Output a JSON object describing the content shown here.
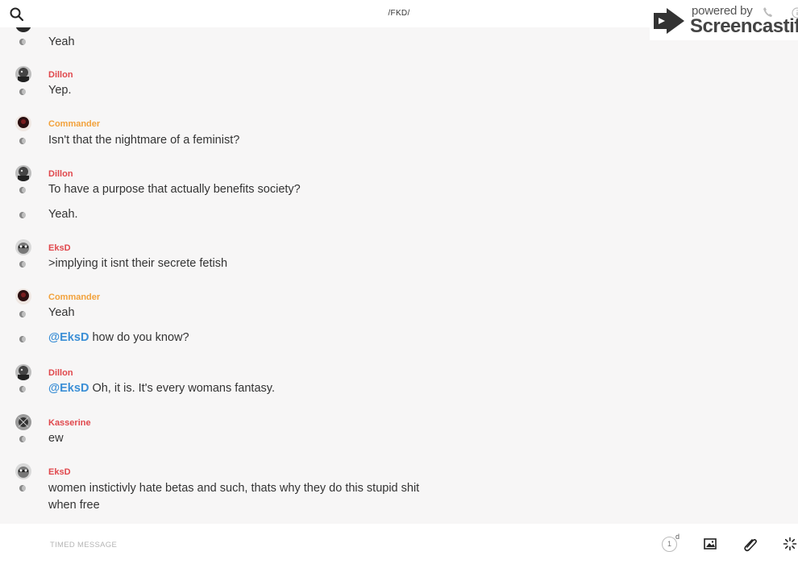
{
  "header": {
    "title": "/FKD/",
    "search_icon": "search-icon"
  },
  "watermark": {
    "powered": "powered by",
    "brand": "Screencastify"
  },
  "messages": [
    {
      "author": "",
      "author_color": "",
      "text": "Yeah",
      "avatar": "avatar-partial"
    },
    {
      "author": "Dillon",
      "author_color": "#e0474c",
      "text": "Yep.",
      "avatar": "dillon-avatar"
    },
    {
      "author": "Commander",
      "author_color": "#f2a23c",
      "text": "Isn't that the nightmare of a feminist?",
      "avatar": "commander-avatar"
    },
    {
      "author": "Dillon",
      "author_color": "#e0474c",
      "text": "To have a purpose that actually benefits society?",
      "avatar": "dillon-avatar"
    },
    {
      "author": "",
      "author_color": "",
      "text": "Yeah.",
      "avatar": ""
    },
    {
      "author": "EksD",
      "author_color": "#e0474c",
      "text": ">implying it isnt their secrete fetish",
      "avatar": "eksd-avatar"
    },
    {
      "author": "Commander",
      "author_color": "#f2a23c",
      "text": "Yeah",
      "avatar": "commander-avatar"
    },
    {
      "author": "",
      "author_color": "",
      "mention": "@EksD",
      "text": " how do you know?",
      "avatar": ""
    },
    {
      "author": "Dillon",
      "author_color": "#e0474c",
      "mention": "@EksD",
      "text": " Oh, it is. It's every womans fantasy.",
      "avatar": "dillon-avatar"
    },
    {
      "author": "Kasserine",
      "author_color": "#e0474c",
      "text": "ew",
      "avatar": "kasserine-avatar"
    },
    {
      "author": "EksD",
      "author_color": "#e0474c",
      "text": "women instictivly hate betas and such, thats why they do this stupid shit when free",
      "avatar": "eksd-avatar"
    }
  ],
  "composer": {
    "placeholder": "TIMED MESSAGE",
    "timer_value": "1",
    "timer_unit": "d"
  },
  "colors": {
    "author_red": "#e0474c",
    "author_orange": "#f2a23c",
    "mention_blue": "#3b8fd6",
    "background": "#f7f6f6"
  }
}
